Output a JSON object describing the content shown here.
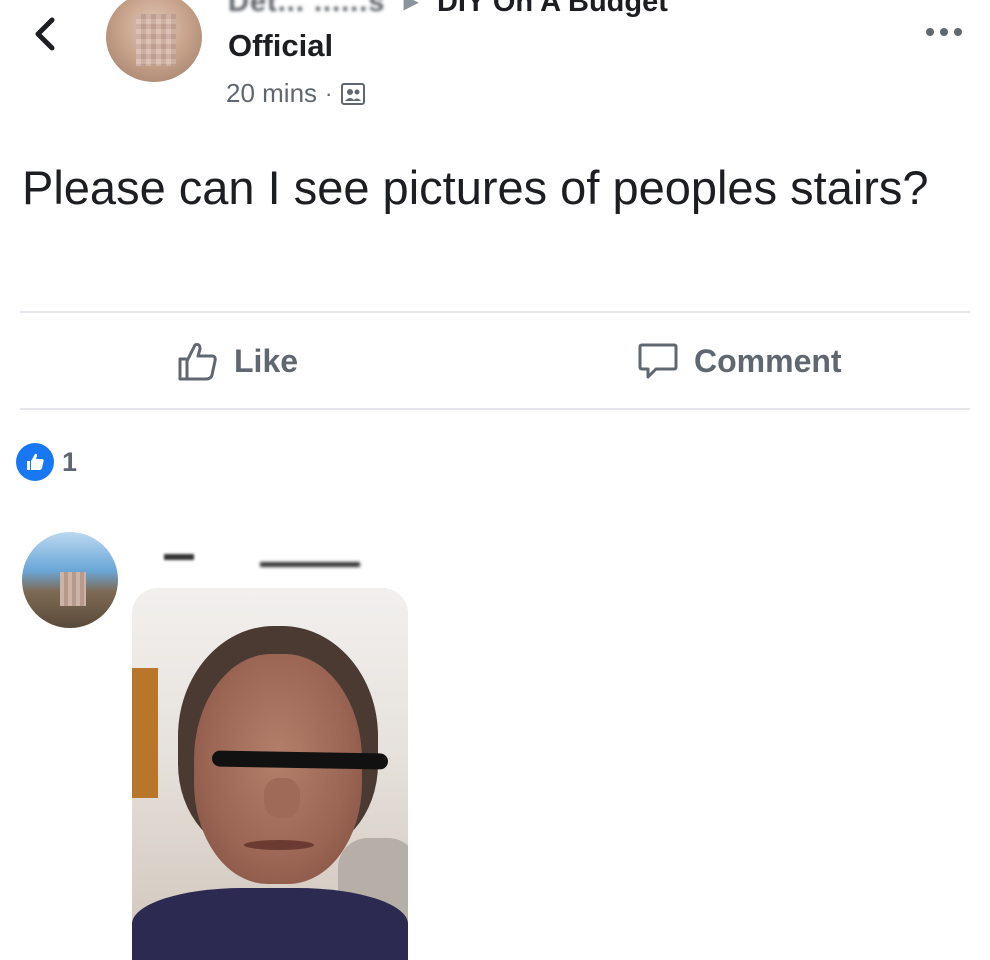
{
  "header": {
    "breadcrumb_author_blurred": "Det... ......s",
    "breadcrumb_group": "DIY On A Budget",
    "author_suffix": "Official",
    "time": "20 mins",
    "separator": "·",
    "privacy_icon": "group-icon"
  },
  "post": {
    "text": "Please can I see pictures of peoples stairs?"
  },
  "actions": {
    "like_label": "Like",
    "comment_label": "Comment"
  },
  "reactions": {
    "count": "1",
    "icon": "like-reaction-icon",
    "color": "#1877f2"
  },
  "colors": {
    "text": "#1c1e21",
    "secondary": "#606770",
    "divider": "#e4e6eb"
  }
}
